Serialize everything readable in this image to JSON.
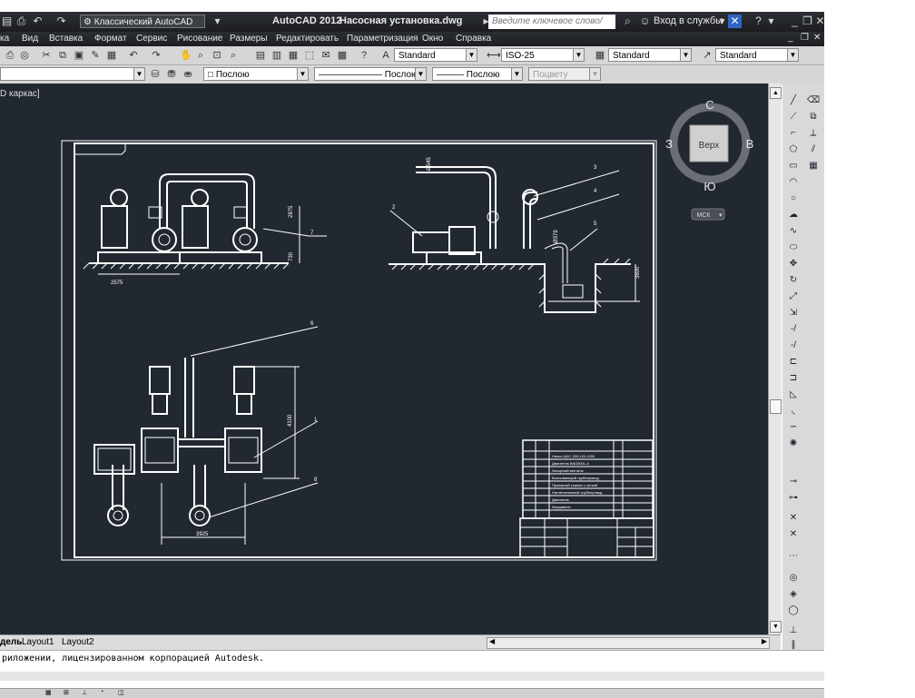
{
  "titlebar": {
    "workspace": "Классический AutoCAD",
    "app_name": "AutoCAD 2012",
    "document": "Насосная установка.dwg",
    "search_placeholder": "Введите ключевое слово/фразу",
    "signin": "Вход в службы",
    "help": "?"
  },
  "menu": {
    "items": [
      "ка",
      "Вид",
      "Вставка",
      "Формат",
      "Сервис",
      "Рисование",
      "Размеры",
      "Редактировать",
      "Параметризация",
      "Окно",
      "Справка"
    ]
  },
  "toolbar1": {
    "text_style": "Standard",
    "dim_style": "ISO-25",
    "table_style": "Standard",
    "multileader_style": "Standard"
  },
  "toolbar2": {
    "color": "Послою",
    "linetype": "Послою",
    "lineweight": "Послою",
    "plotstyle": "Поцвету"
  },
  "viewport": {
    "label": "D каркас]"
  },
  "viewcube": {
    "north": "С",
    "south": "Ю",
    "east": "В",
    "west": "З",
    "face": "Верх",
    "ucs": "МСК"
  },
  "drawing": {
    "dims": {
      "front_width": "2575",
      "front_height": "2875",
      "front_base": "730",
      "side_pipe": "Ø545",
      "side_height": "3800",
      "side_depth": "Ø379",
      "plan_height": "4100",
      "plan_width": "3925"
    },
    "leaders": [
      "1",
      "2",
      "3",
      "4",
      "5",
      "6",
      "7",
      "8"
    ],
    "spec_rows": [
      "Насос ЦНС 300-120-1000",
      "Двигатель ВАО500L-4",
      "Запорный вентиль",
      "Всасывающий трубопровод",
      "Приемный клапан с сеткой",
      "Нагнетательный трубопровод",
      "Двигатель",
      "Фундамент"
    ]
  },
  "tabs": {
    "model": "дель",
    "layout1": "Layout1",
    "layout2": "Layout2"
  },
  "command": {
    "line1": "риложении, лицензированном корпорацией Autodesk."
  },
  "colors": {
    "viewport_bg": "#212830",
    "drawing_lines": "#ffffff",
    "titlebar_bg": "#1e2024"
  }
}
